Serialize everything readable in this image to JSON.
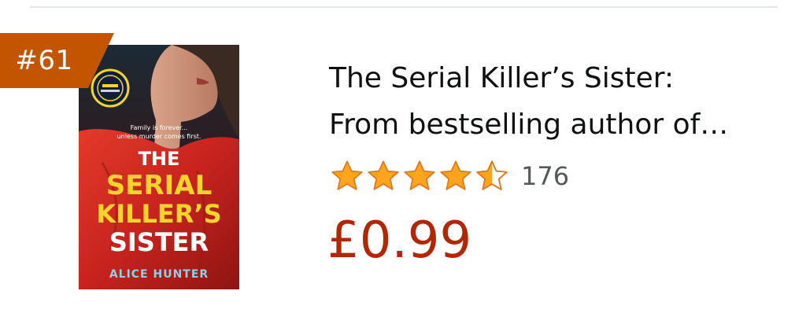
{
  "product": {
    "rank": "#61",
    "title_line1": "The Serial Killer’s Sister:",
    "title_line2": "From bestselling author of…",
    "rating": 4.5,
    "rating_max": 5,
    "review_count": "176",
    "price": "£0.99",
    "cover": {
      "tagline_line1": "Family is forever...",
      "tagline_line2": "unless murder comes first.",
      "title_line1": "THE",
      "title_line2": "SERIAL",
      "title_line3": "KILLER’S",
      "title_line4": "SISTER",
      "author": "ALICE HUNTER"
    }
  },
  "colors": {
    "badge": "#c45500",
    "star": "#ffa41c",
    "star_stroke": "#de7921",
    "price": "#b12704",
    "title_text": "#0f1111",
    "count_text": "#565959",
    "cover_red": "#c8231e",
    "cover_yellow": "#f5d628"
  },
  "icons": {
    "star_full": "star-full-icon",
    "star_half": "star-half-icon"
  }
}
